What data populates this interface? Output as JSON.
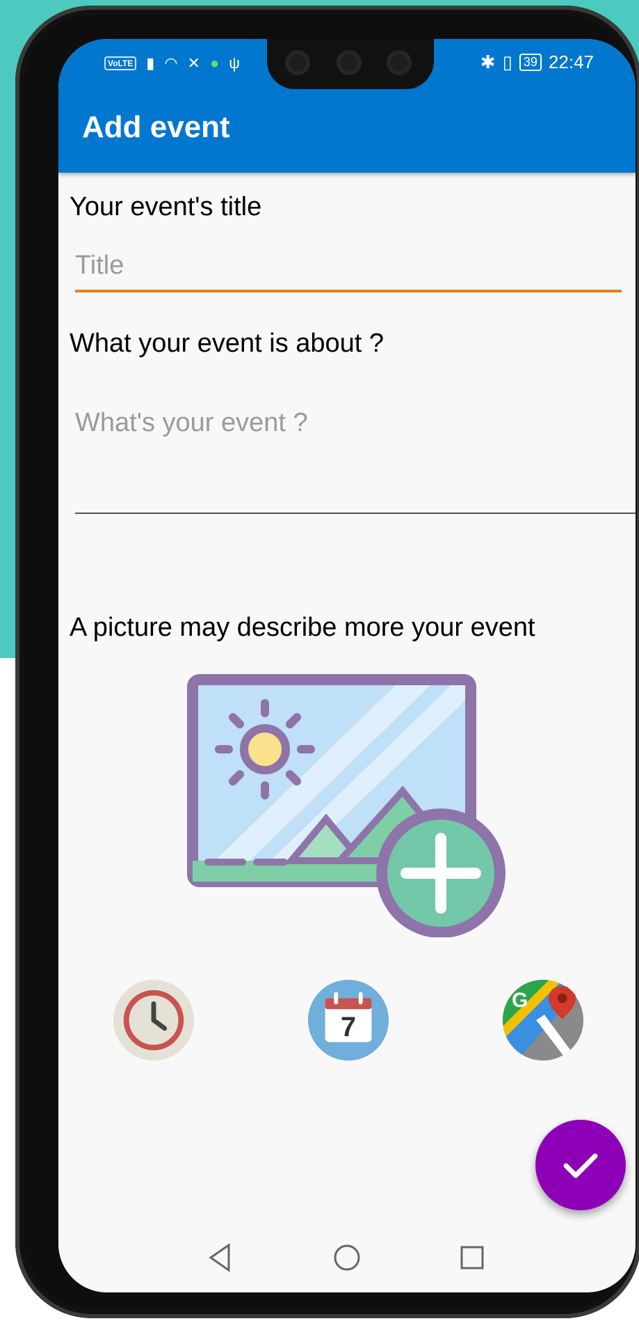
{
  "status_bar": {
    "volte": "VoLTE",
    "time": "22:47",
    "battery": "39"
  },
  "app_bar": {
    "title": "Add event"
  },
  "form": {
    "title_label": "Your event's title",
    "title_placeholder": "Title",
    "desc_label": "What your event is about ?",
    "desc_placeholder": "What's your event ?",
    "picture_label": "A picture may describe more your event"
  },
  "colors": {
    "app_bar": "#0277d0",
    "accent_underline": "#e67e22",
    "fab": "#8e00b8",
    "background_teal": "#4dcac0"
  },
  "icons": [
    "add-image-icon",
    "clock-icon",
    "calendar-icon",
    "google-maps-icon",
    "check-icon"
  ],
  "calendar_day": "7",
  "maps_letter": "G"
}
